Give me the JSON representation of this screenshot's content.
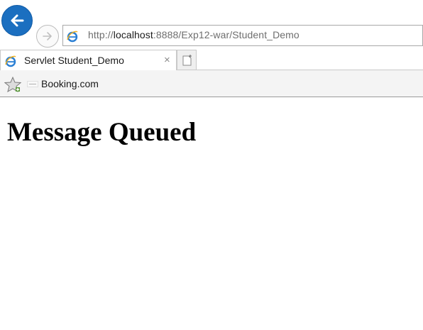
{
  "browser": {
    "address_bar": {
      "url_prefix": "http://",
      "url_host": "localhost",
      "url_rest": ":8888/Exp12-war/Student_Demo"
    },
    "tabs": [
      {
        "title": "Servlet Student_Demo",
        "close_label": "×"
      }
    ],
    "favorites": [
      {
        "label": "Booking.com"
      }
    ],
    "colors": {
      "back_button": "#1b6fc0"
    }
  },
  "page": {
    "heading": "Message Queued"
  }
}
